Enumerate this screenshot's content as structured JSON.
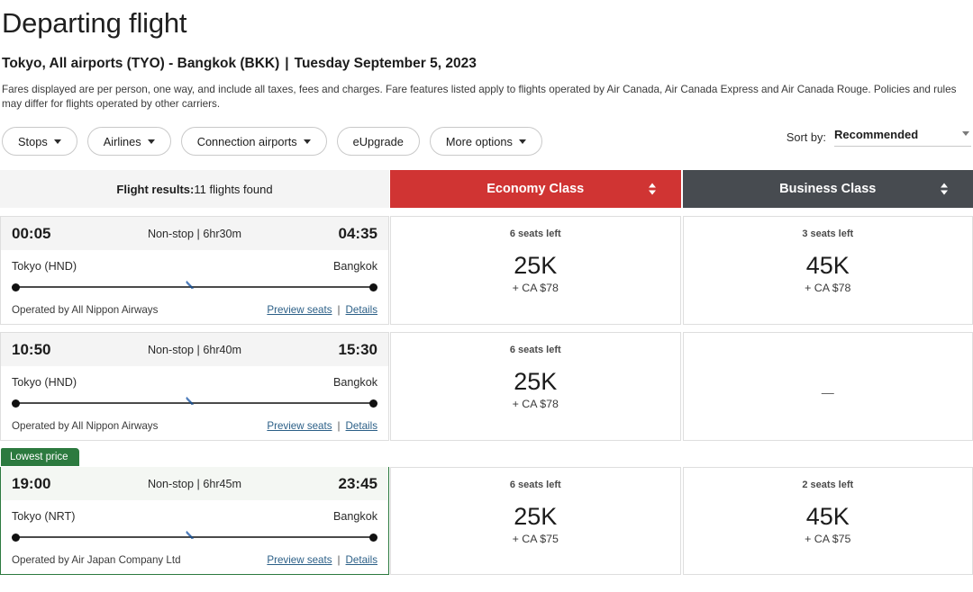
{
  "header": {
    "title": "Departing flight",
    "route": "Tokyo, All airports (TYO) - Bangkok (BKK)",
    "route_separator": "|",
    "date": "Tuesday September 5, 2023",
    "disclaimer": "Fares displayed are per person, one way, and include all taxes, fees and charges. Fare features listed apply to flights operated by Air Canada, Air Canada Express and Air Canada Rouge. Policies and rules may differ for flights operated by other carriers."
  },
  "filters": [
    {
      "label": "Stops",
      "has_caret": true
    },
    {
      "label": "Airlines",
      "has_caret": true
    },
    {
      "label": "Connection airports",
      "has_caret": true
    },
    {
      "label": "eUpgrade",
      "has_caret": false
    },
    {
      "label": "More options",
      "has_caret": true
    }
  ],
  "sort": {
    "label": "Sort by:",
    "value": "Recommended"
  },
  "results_header": {
    "label": "Flight results:",
    "count_text": "11 flights found",
    "economy": "Economy Class",
    "business": "Business Class"
  },
  "colors": {
    "economy_header": "#d03433",
    "business_header": "#474b50",
    "lowest_price_badge": "#2c7a3f",
    "link": "#2b5f87"
  },
  "flights": [
    {
      "badge": "",
      "depart_time": "00:05",
      "arrive_time": "04:35",
      "stops": "Non-stop | 6hr30m",
      "origin": "Tokyo (HND)",
      "destination": "Bangkok",
      "operator": "Operated by All Nippon Airways",
      "preview_seats": "Preview seats",
      "details": "Details",
      "economy": {
        "seats": "6 seats left",
        "miles": "25K",
        "cash": "+ CA $78",
        "available": true
      },
      "business": {
        "seats": "3 seats left",
        "miles": "45K",
        "cash": "+ CA $78",
        "available": true
      }
    },
    {
      "badge": "",
      "depart_time": "10:50",
      "arrive_time": "15:30",
      "stops": "Non-stop | 6hr40m",
      "origin": "Tokyo (HND)",
      "destination": "Bangkok",
      "operator": "Operated by All Nippon Airways",
      "preview_seats": "Preview seats",
      "details": "Details",
      "economy": {
        "seats": "6 seats left",
        "miles": "25K",
        "cash": "+ CA $78",
        "available": true
      },
      "business": {
        "seats": "",
        "miles": "",
        "cash": "",
        "available": false,
        "unavailable_mark": "—"
      }
    },
    {
      "badge": "Lowest price",
      "depart_time": "19:00",
      "arrive_time": "23:45",
      "stops": "Non-stop | 6hr45m",
      "origin": "Tokyo (NRT)",
      "destination": "Bangkok",
      "operator": "Operated by Air Japan Company Ltd",
      "preview_seats": "Preview seats",
      "details": "Details",
      "economy": {
        "seats": "6 seats left",
        "miles": "25K",
        "cash": "+ CA $75",
        "available": true
      },
      "business": {
        "seats": "2 seats left",
        "miles": "45K",
        "cash": "+ CA $75",
        "available": true
      }
    }
  ]
}
